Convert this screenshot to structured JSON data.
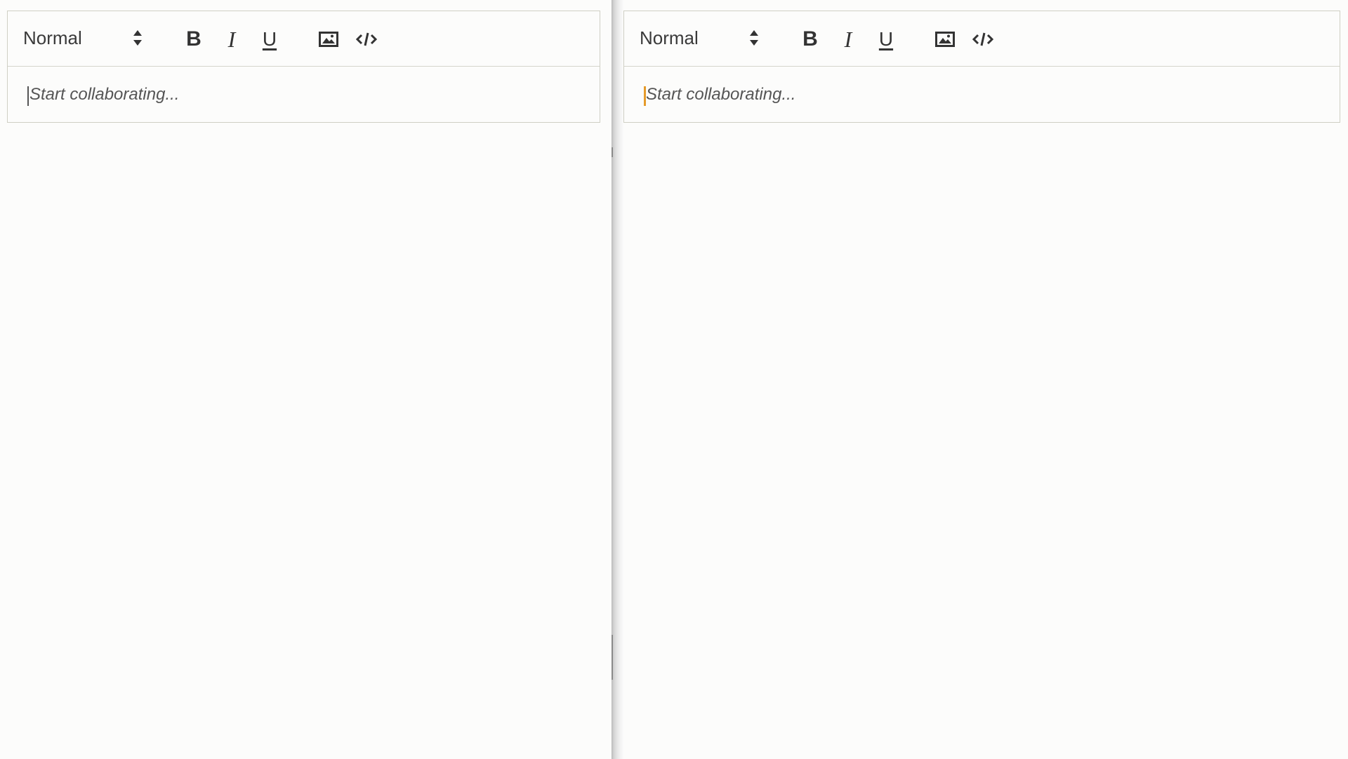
{
  "editors": [
    {
      "id": "left",
      "format_select": {
        "value": "Normal"
      },
      "toolbar": {
        "bold_label": "B",
        "italic_label": "I",
        "underline_label": "U"
      },
      "content": {
        "placeholder": "Start collaborating..."
      },
      "caret_color": "#555555"
    },
    {
      "id": "right",
      "format_select": {
        "value": "Normal"
      },
      "toolbar": {
        "bold_label": "B",
        "italic_label": "I",
        "underline_label": "U"
      },
      "content": {
        "placeholder": "Start collaborating..."
      },
      "caret_color": "#e59a2a"
    }
  ],
  "icons": {
    "format_dropdown": "updown-arrows-icon",
    "image": "image-icon",
    "code": "code-icon"
  },
  "colors": {
    "background": "#fcfcfb",
    "border": "#cfcfc4",
    "text": "#333333",
    "remote_caret": "#e59a2a"
  }
}
